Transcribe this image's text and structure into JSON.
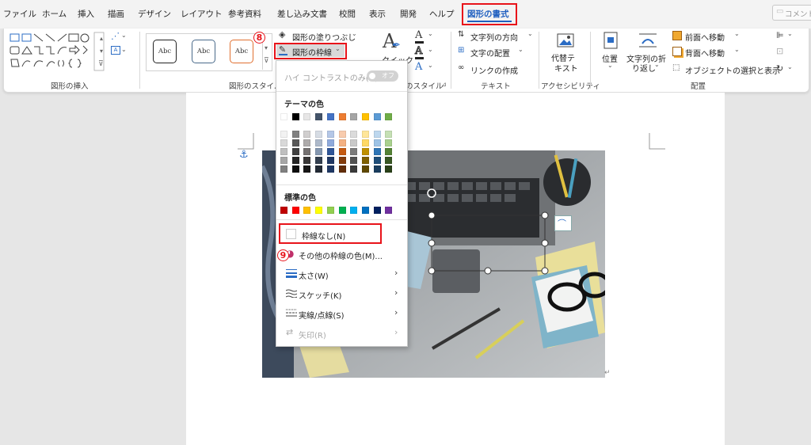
{
  "tabs": [
    "ファイル",
    "ホーム",
    "挿入",
    "描画",
    "デザイン",
    "レイアウト",
    "参考資料",
    "差し込み文書",
    "校閲",
    "表示",
    "開発",
    "ヘルプ",
    "図形の書式"
  ],
  "comment_button": "コメント",
  "ribbon": {
    "groups": {
      "insert_shapes": "図形の挿入",
      "shape_styles": "図形のスタイル",
      "wordart_styles": "のスタイル",
      "text": "テキスト",
      "accessibility": "アクセシビリティ",
      "arrange": "配置"
    },
    "style_samples": [
      "Abc",
      "Abc",
      "Abc"
    ],
    "fill_label": "図形の塗りつぶし",
    "outline_label": "図形の枠線",
    "quick_label": "クイック",
    "text_direction": "文字列の方向",
    "text_align": "文字の配置",
    "link": "リンクの作成",
    "alt_text": [
      "代替テ",
      "キスト"
    ],
    "position": "位置",
    "wrap": [
      "文字列の折",
      "り返し"
    ],
    "bring_forward": "前面へ移動",
    "send_backward": "背面へ移動",
    "selection_pane": "オブジェクトの選択と表示"
  },
  "steps": [
    "8",
    "9"
  ],
  "dropdown": {
    "high_contrast": "ハイ コントラストのみ(H)",
    "toggle_state": "オフ",
    "theme_colors_title": "テーマの色",
    "standard_colors_title": "標準の色",
    "no_outline": "枠線なし(N)",
    "more_colors": "その他の枠線の色(M)...",
    "weight": "太さ(W)",
    "sketch": "スケッチ(K)",
    "dashes": "実線/点線(S)",
    "arrows": "矢印(R)",
    "theme_top_row": [
      "#ffffff",
      "#000000",
      "#e7e6e6",
      "#44546a",
      "#4472c4",
      "#ed7d31",
      "#a5a5a5",
      "#ffc000",
      "#5b9bd5",
      "#70ad47"
    ],
    "theme_columns": [
      [
        "#f2f2f2",
        "#d9d9d9",
        "#bfbfbf",
        "#a6a6a6",
        "#808080"
      ],
      [
        "#808080",
        "#595959",
        "#404040",
        "#262626",
        "#0d0d0d"
      ],
      [
        "#d0cece",
        "#aeabab",
        "#757171",
        "#3a3838",
        "#171616"
      ],
      [
        "#d6dce4",
        "#adb9ca",
        "#8497b0",
        "#333f4f",
        "#222a35"
      ],
      [
        "#b4c7e7",
        "#8faadc",
        "#2f5597",
        "#203864",
        "#1f3864"
      ],
      [
        "#f8cbad",
        "#f4b183",
        "#c55a11",
        "#843c0c",
        "#622d09"
      ],
      [
        "#dbdbdb",
        "#c9c9c9",
        "#7b7b7b",
        "#525252",
        "#3a3a3a"
      ],
      [
        "#ffe699",
        "#ffd966",
        "#bf9000",
        "#7f6000",
        "#5f4800"
      ],
      [
        "#bdd7ee",
        "#9dc3e6",
        "#2e75b6",
        "#1f4e79",
        "#1a3d5e"
      ],
      [
        "#c5e0b4",
        "#a9d18e",
        "#548235",
        "#385723",
        "#2a4119"
      ]
    ],
    "standard_colors": [
      "#c00000",
      "#ff0000",
      "#ffc000",
      "#ffff00",
      "#92d050",
      "#00b050",
      "#00b0f0",
      "#0070c0",
      "#002060",
      "#7030a0"
    ]
  }
}
